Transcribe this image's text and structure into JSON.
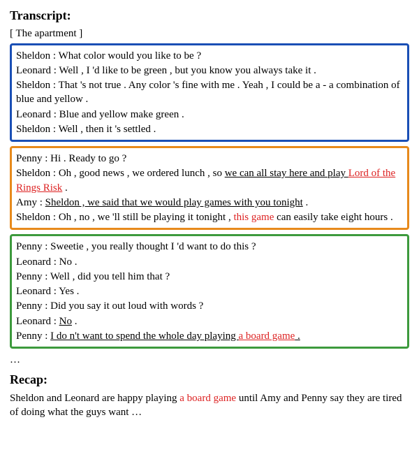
{
  "transcript_heading": "Transcript:",
  "scene": "[ The apartment ]",
  "seg1": {
    "l1_sp": "Sheldon : ",
    "l1_txt": "What color would you like to be ?",
    "l2_sp": "Leonard : ",
    "l2_txt": "Well , I 'd like to be green , but you know you always take it .",
    "l3_sp": "Sheldon : ",
    "l3_txt": "That 's not true . Any color 's fine with me . Yeah , I could be a - a combination of blue and yellow .",
    "l4_sp": "Leonard : ",
    "l4_txt": "Blue and yellow make green .",
    "l5_sp": "Sheldon : ",
    "l5_txt": "Well , then it 's settled ."
  },
  "seg2": {
    "l1_sp": "Penny : ",
    "l1_txt": "Hi . Ready to go ?",
    "l2_sp": "Sheldon : ",
    "l2_a": "Oh , good news , we ordered lunch , so ",
    "l2_b": "we can all stay here and play ",
    "l2_c": "Lord of the Rings Risk",
    "l2_d": " .",
    "l3_sp": "Amy : ",
    "l3_txt": "Sheldon , we said that we would play games with you tonight",
    "l3_end": " .",
    "l4_sp": "Sheldon : ",
    "l4_a": "Oh , no , we 'll still be playing it tonight , ",
    "l4_b": "this game",
    "l4_c": " can easily take eight hours ."
  },
  "seg3": {
    "l1_sp": "Penny : ",
    "l1_txt": "Sweetie , you really thought I 'd want to do this ?",
    "l2_sp": "Leonard : ",
    "l2_txt": "No .",
    "l3_sp": "Penny : ",
    "l3_txt": "Well , did you tell him that ?",
    "l4_sp": "Leonard : ",
    "l4_txt": "Yes .",
    "l5_sp": "Penny : ",
    "l5_txt": "Did you say it out loud with words ?",
    "l6_sp": "Leonard : ",
    "l6_txt": "No",
    "l6_end": " .",
    "l7_sp": "Penny : ",
    "l7_a": "I do n't want to spend the whole day playing ",
    "l7_b": "a board game",
    "l7_c": " ."
  },
  "ellipsis": "…",
  "recap_heading": "Recap:",
  "recap": {
    "a": "Sheldon and Leonard are happy playing ",
    "b": "a board game",
    "c": " until Amy and Penny say they are tired of doing what the guys want …"
  }
}
